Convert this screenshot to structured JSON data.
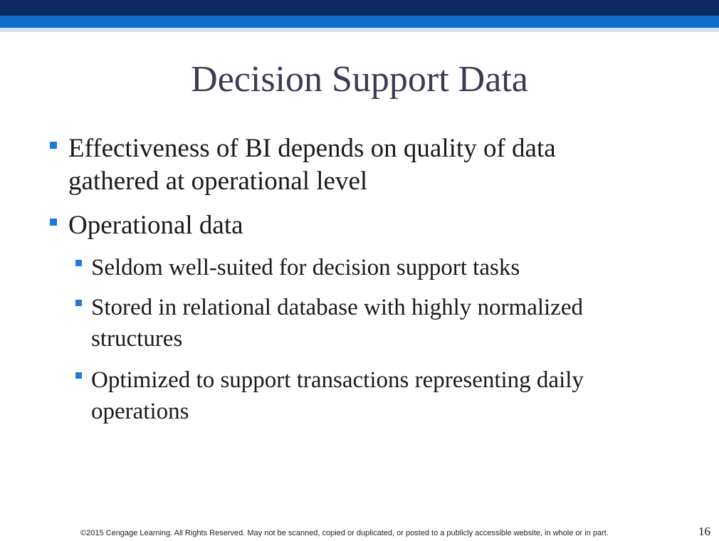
{
  "slide": {
    "title": "Decision Support Data",
    "bullets": [
      {
        "level": 1,
        "lines": [
          "Effectiveness of BI depends on quality of data",
          "gathered at operational level"
        ]
      },
      {
        "level": 1,
        "lines": [
          "Operational data"
        ]
      },
      {
        "level": 2,
        "lines": [
          "Seldom well-suited for decision support tasks"
        ]
      },
      {
        "level": 2,
        "lines": [
          "Stored in relational database with highly normalized",
          "structures"
        ]
      },
      {
        "level": 2,
        "lines": [
          "Optimized to support transactions representing daily",
          "operations"
        ]
      }
    ],
    "footer": "©2015 Cengage Learning. All Rights Reserved. May not be scanned, copied or duplicated, or posted to a publicly accessible website, in whole or in part.",
    "page_number": "16"
  },
  "colors": {
    "top_band_dark": "#0e2a63",
    "top_band_mid": "#0f6fc6",
    "bullet": "#1f7ad6",
    "title_text": "#3b3b55"
  }
}
